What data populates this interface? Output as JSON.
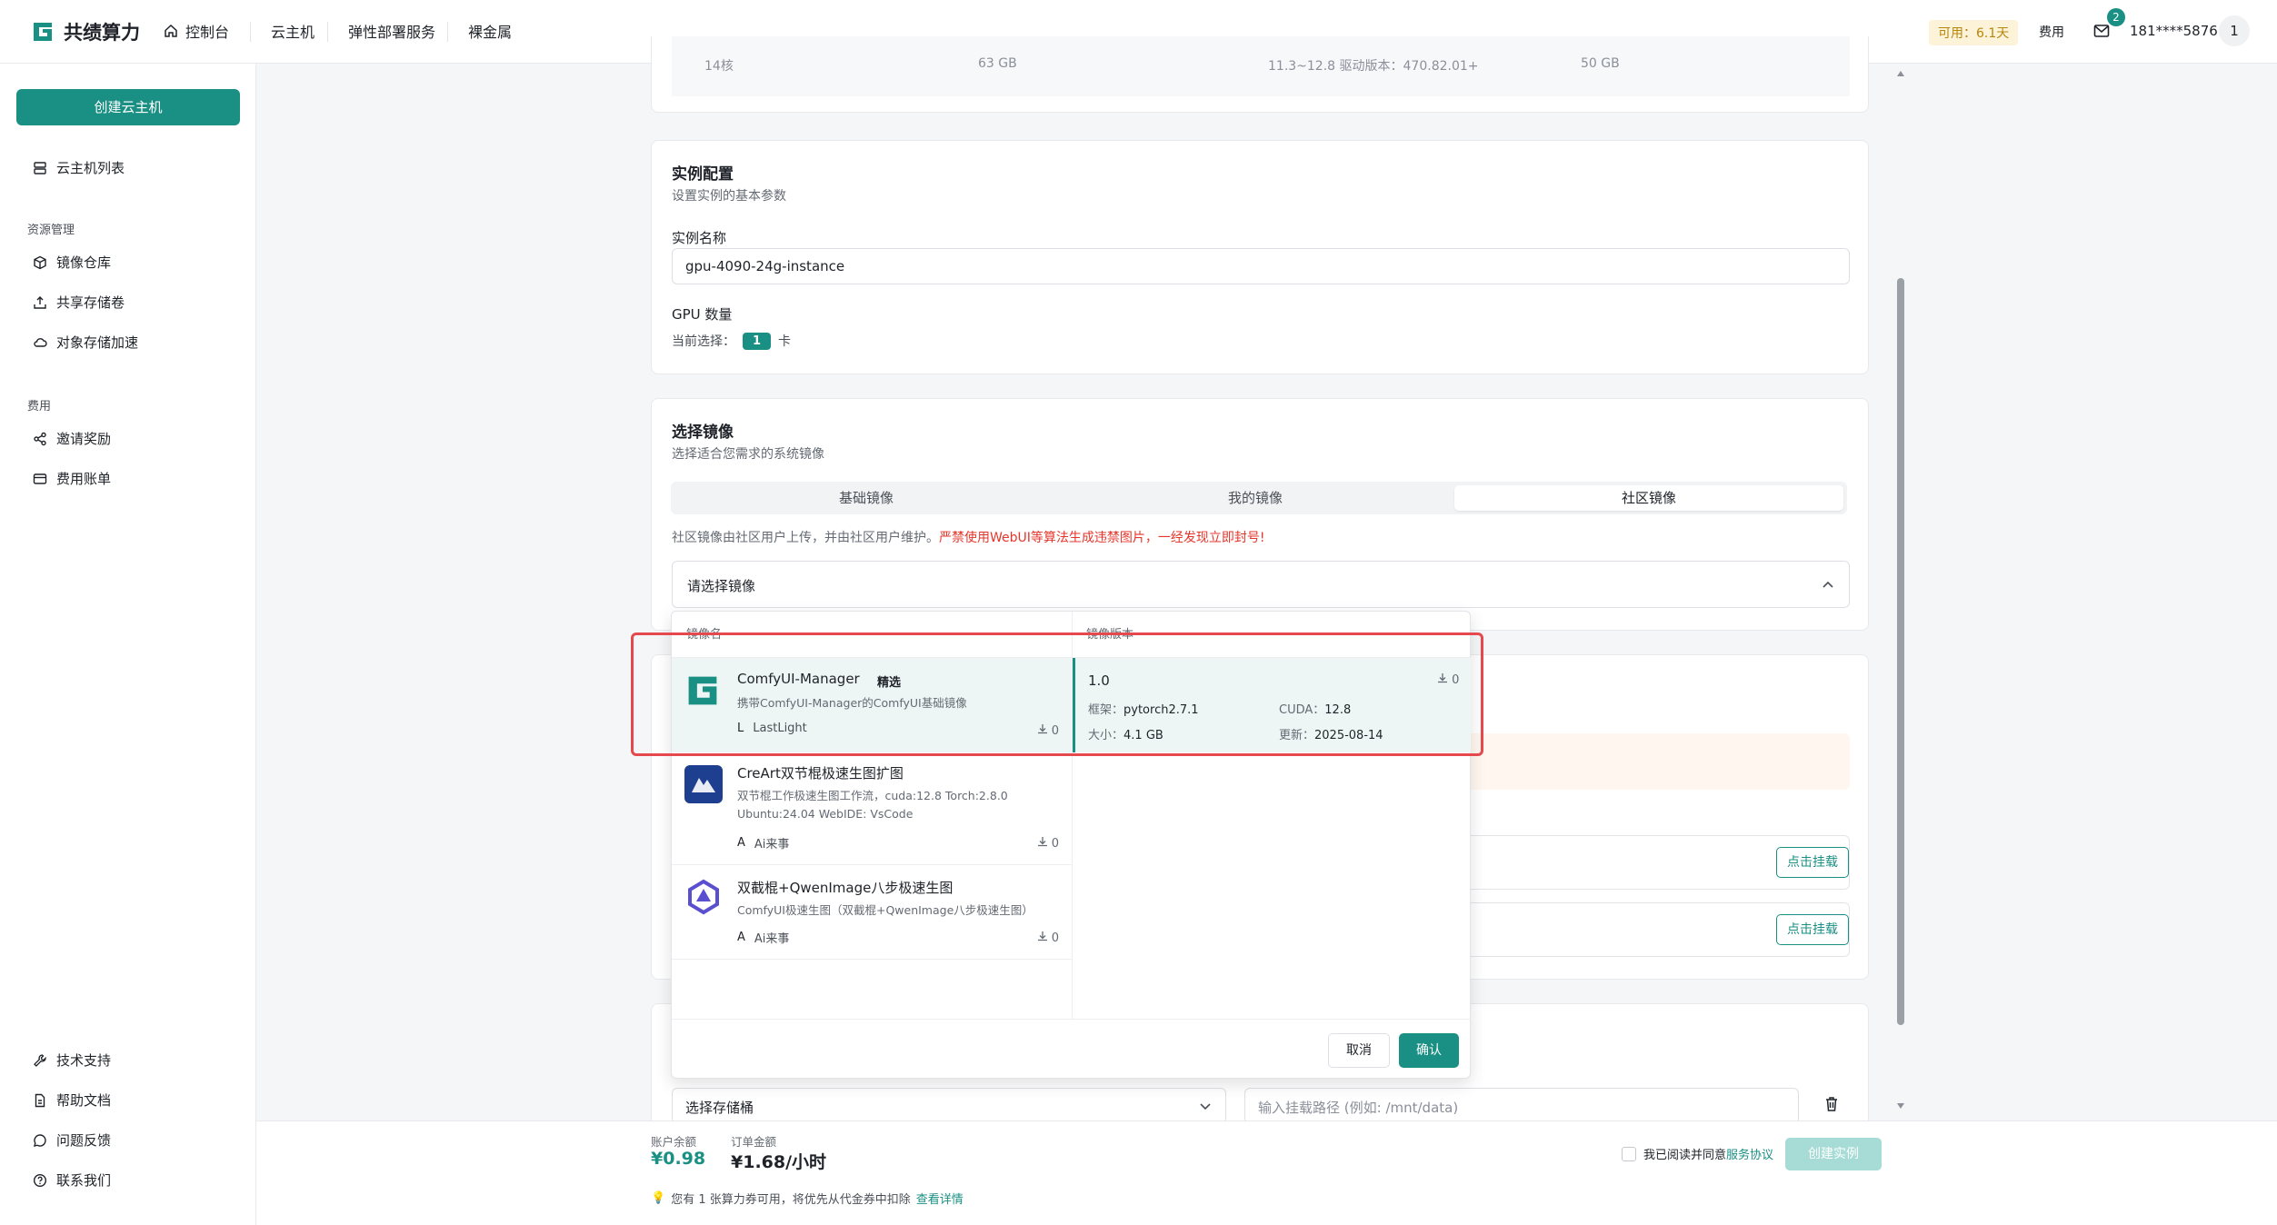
{
  "brand": {
    "name": "共绩算力"
  },
  "nav": {
    "console": "控制台",
    "cloud_host": "云主机",
    "elastic": "弹性部署服务",
    "bare_metal": "裸金属"
  },
  "header": {
    "available": "可用：6.1天",
    "fee": "费用",
    "mail_count": "2",
    "user": "181****5876",
    "avatar": "1"
  },
  "sidebar": {
    "create_button": "创建云主机",
    "host_list": "云主机列表",
    "group_resource": "资源管理",
    "image_repo": "镜像仓库",
    "shared_storage": "共享存储卷",
    "object_storage": "对象存储加速",
    "group_fee": "费用",
    "invite": "邀请奖励",
    "bill": "费用账单",
    "tech_support": "技术支持",
    "help_docs": "帮助文档",
    "feedback": "问题反馈",
    "contact": "联系我们"
  },
  "top_partial": {
    "cores": "14核",
    "mem": "63 GB",
    "cuda": "11.3~12.8 驱动版本：470.82.01+",
    "disk": "50 GB"
  },
  "instance": {
    "title": "实例配置",
    "subtitle": "设置实例的基本参数",
    "name_label": "实例名称",
    "name_value": "gpu-4090-24g-instance",
    "gpu_label": "GPU 数量",
    "current_label": "当前选择：",
    "gpu_count": "1",
    "gpu_unit": "卡"
  },
  "image": {
    "title": "选择镜像",
    "subtitle": "选择适合您需求的系统镜像",
    "tabs": [
      "基础镜像",
      "我的镜像",
      "社区镜像"
    ],
    "notice_normal": "社区镜像由社区用户上传，并由社区用户维护。",
    "notice_warn": "严禁使用WebUI等算法生成违禁图片，一经发现立即封号!",
    "select_placeholder": "请选择镜像",
    "col_name": "镜像名",
    "col_version": "镜像版本",
    "items": [
      {
        "name": "ComfyUI-Manager",
        "tag": "精选",
        "desc": "携带ComfyUI-Manager的ComfyUI基础镜像",
        "author_initial": "L",
        "author": "LastLight",
        "downloads": "0"
      },
      {
        "name": "CreArt双节棍极速生图扩图",
        "desc1": "双节棍工作极速生图工作流，cuda:12.8 Torch:2.8.0",
        "desc2": "Ubuntu:24.04 WebIDE: VsCode",
        "author_initial": "A",
        "author": "Ai来事",
        "downloads": "0"
      },
      {
        "name": "双截棍+QwenImage八步极速生图",
        "desc": "ComfyUI极速生图（双截棍+QwenImage八步极速生图）",
        "author_initial": "A",
        "author": "Ai来事",
        "downloads": "0"
      }
    ],
    "version": {
      "number": "1.0",
      "downloads": "0",
      "framework_label": "框架：",
      "framework": "pytorch2.7.1",
      "cuda_label": "CUDA：",
      "cuda": "12.8",
      "size_label": "大小：",
      "size": "4.1 GB",
      "updated_label": "更新：",
      "updated": "2025-08-14"
    },
    "cancel": "取消",
    "confirm": "确认"
  },
  "storage": {
    "mount_label": "点击挂载",
    "bucket_placeholder": "选择存储桶",
    "path_placeholder": "输入挂载路径 (例如: /mnt/data)"
  },
  "footer": {
    "balance_label": "账户余额",
    "balance": "¥0.98",
    "order_label": "订单金额",
    "order": "¥1.68/小时",
    "agree_text": "我已阅读并同意",
    "agree_link": "服务协议",
    "create_btn": "创建实例",
    "coupon_text": "您有 1 张算力券可用，将优先从代金券中扣除",
    "coupon_link": "查看详情"
  },
  "colors": {
    "accent": "#1a8f83",
    "warn": "#e5362b",
    "highlight": "#e5484d"
  }
}
